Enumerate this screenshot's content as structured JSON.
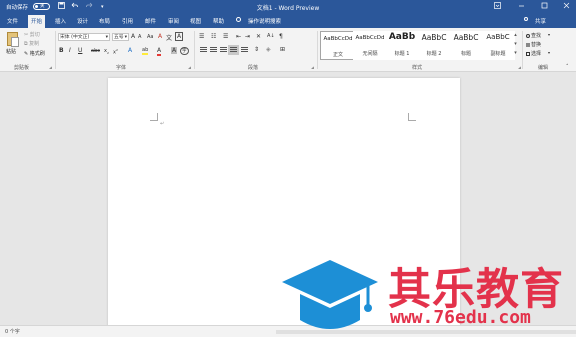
{
  "colors": {
    "accent": "#2b579a",
    "ribbon": "#f3f3f3",
    "canvas": "#e6e6e6",
    "watermark_red": "#e3324b",
    "watermark_blue": "#1d8fd6"
  },
  "titlebar": {
    "autosave_label": "自动保存",
    "autosave_state": "关",
    "document_title": "文档1 - Word Preview",
    "icons": [
      "save-icon",
      "undo-icon",
      "redo-icon",
      "customize-icon",
      "ribbon-display-icon",
      "minimize-icon",
      "maximize-icon",
      "close-icon"
    ]
  },
  "tabs": {
    "items": [
      "文件",
      "开始",
      "插入",
      "设计",
      "布局",
      "引用",
      "邮件",
      "审阅",
      "视图",
      "帮助"
    ],
    "active": "开始",
    "search_label": "操作说明搜索",
    "share_label": "共享"
  },
  "clipboard": {
    "paste_label": "粘贴",
    "cut_label": "剪切",
    "copy_label": "复制",
    "format_painter_label": "格式刷",
    "group_label": "剪贴板"
  },
  "font": {
    "font_name": "宋体 (中文正)",
    "font_size": "五号",
    "grow_label": "A",
    "shrink_label": "A",
    "case_label": "Aa",
    "clear_label": "A",
    "phonetic_label": "文",
    "border_label": "A",
    "bold_label": "B",
    "italic_label": "I",
    "underline_label": "U",
    "strike_label": "abc",
    "subscript_label": "x",
    "superscript_label": "x",
    "effects_label": "A",
    "highlight_label": "ab",
    "color_label": "A",
    "shading_label": "A",
    "enclose_label": "字",
    "group_label": "字体"
  },
  "paragraph": {
    "sort_label": "A",
    "marks_label": "¶",
    "group_label": "段落"
  },
  "styles": {
    "items": [
      {
        "sample": "AaBbCcDd",
        "name": "正文",
        "selected": true
      },
      {
        "sample": "AaBbCcDd",
        "name": "无间隔",
        "selected": false
      },
      {
        "sample": "AaBb",
        "name": "标题 1",
        "selected": false
      },
      {
        "sample": "AaBbC",
        "name": "标题 2",
        "selected": false
      },
      {
        "sample": "AaBbC",
        "name": "标题",
        "selected": false
      },
      {
        "sample": "AaBbC",
        "name": "副标题",
        "selected": false
      }
    ],
    "group_label": "样式"
  },
  "editing": {
    "find_label": "查找",
    "replace_label": "替换",
    "select_label": "选择",
    "group_label": "编辑"
  },
  "document": {
    "paragraph_mark": "↵"
  },
  "status": {
    "word_count": "0 个字"
  },
  "watermark": {
    "title": "其乐教育",
    "url": "www.76edu.com"
  }
}
